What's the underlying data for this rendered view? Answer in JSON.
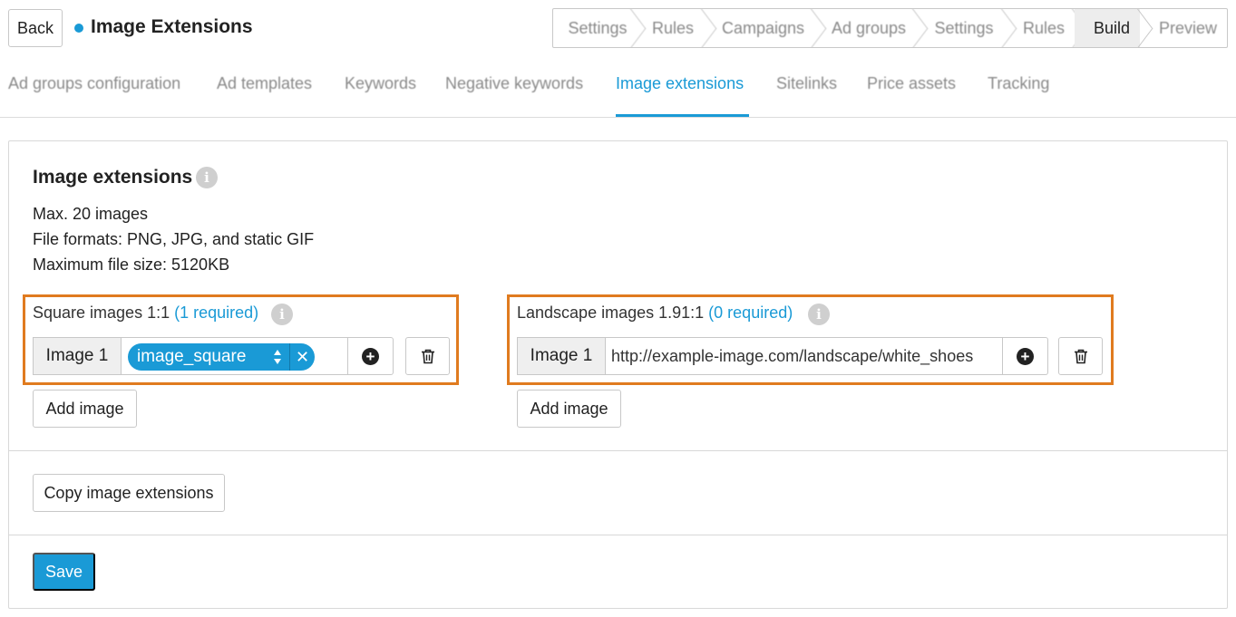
{
  "header": {
    "back_label": "Back",
    "title": "Image Extensions",
    "accent": "#1a9ad6"
  },
  "stepper": {
    "steps": [
      "Settings",
      "Rules",
      "Campaigns",
      "Ad groups",
      "Settings",
      "Rules",
      "Build",
      "Preview"
    ],
    "active_index": 6
  },
  "tabs": {
    "items": [
      "Ad groups configuration",
      "Ad templates",
      "Keywords",
      "Negative keywords",
      "Image extensions",
      "Sitelinks",
      "Price assets",
      "Tracking"
    ],
    "active_index": 4
  },
  "section": {
    "title": "Image extensions",
    "info_icon": "info-icon",
    "lines": [
      "Max. 20 images",
      "File formats: PNG, JPG, and static GIF",
      "Maximum file size: 5120KB"
    ]
  },
  "square": {
    "label": "Square images 1:1",
    "required": "(1 required)",
    "row_label": "Image 1",
    "chip_value": "image_square",
    "add_label": "Add image"
  },
  "landscape": {
    "label": "Landscape images 1.91:1",
    "required": "(0 required)",
    "row_label": "Image 1",
    "url_value": "http://example-image.com/landscape/white_shoes",
    "add_label": "Add image"
  },
  "copy_label": "Copy image extensions",
  "save_label": "Save",
  "highlight_color": "#e07b1f"
}
